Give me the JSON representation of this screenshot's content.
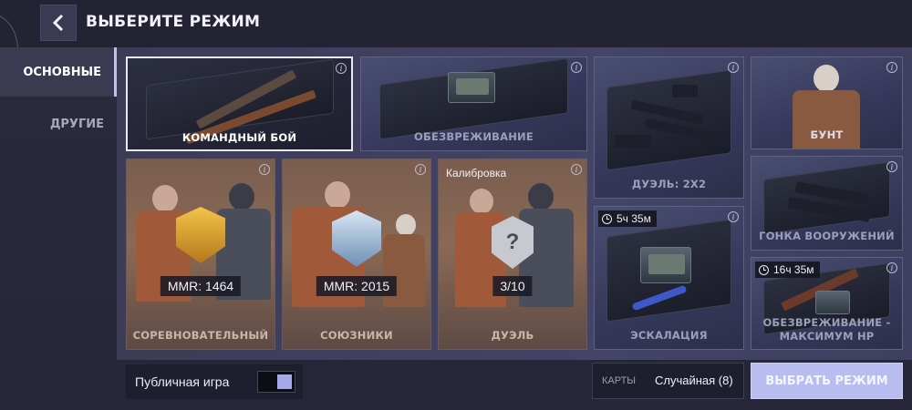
{
  "header": {
    "title": "ВЫБЕРИТЕ РЕЖИМ"
  },
  "tabs": [
    {
      "label": "ОСНОВНЫЕ",
      "active": true
    },
    {
      "label": "ДРУГИЕ",
      "active": false
    }
  ],
  "info_glyph": "i",
  "cards": {
    "team": {
      "label": "КОМАНДНЫЙ БОЙ",
      "selected": true
    },
    "defuse": {
      "label": "ОБЕЗВРЕЖИВАНИЕ"
    },
    "duel2x2": {
      "label": "ДУЭЛЬ: 2Х2"
    },
    "riot": {
      "label": "БУНТ"
    },
    "competitive": {
      "label": "СОРЕВНОВАТЕЛЬНЫЙ",
      "mmr": "MMR: 1464"
    },
    "allies": {
      "label": "СОЮЗНИКИ",
      "mmr": "MMR: 2015"
    },
    "duel": {
      "label": "ДУЭЛЬ",
      "calibration": "Калибровка",
      "progress": "3/10",
      "emblem_glyph": "?"
    },
    "arms_race": {
      "label": "ГОНКА ВООРУЖЕНИЙ"
    },
    "escalation": {
      "label": "ЭСКАЛАЦИЯ",
      "timer": "5ч 35м"
    },
    "defuse_max_hp": {
      "label_line1": "ОБЕЗВРЕЖИВАНИЕ -",
      "label_line2": "МАКСИМУМ HP",
      "timer": "16ч 35м"
    }
  },
  "footer": {
    "public_game_label": "Публичная игра",
    "public_game_enabled": true,
    "maps_label": "КАРТЫ",
    "maps_value": "Случайная (8)",
    "select_button": "ВЫБРАТЬ РЕЖИМ"
  },
  "colors": {
    "accent": "#b8bcef",
    "toggle_knob": "#a6a9e8",
    "background": "#2a2b3e"
  }
}
